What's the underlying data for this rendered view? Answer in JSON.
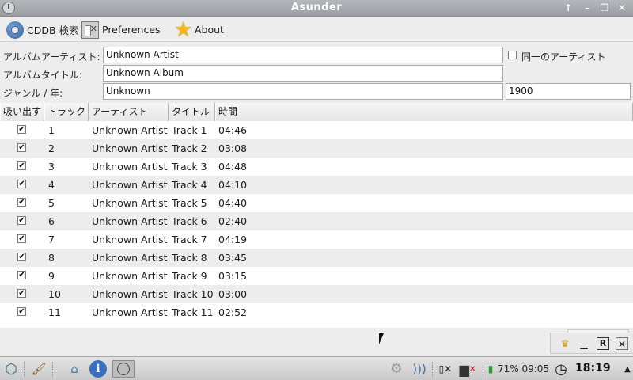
{
  "window": {
    "title": "Asunder",
    "buttons": {
      "up": "↑",
      "minimize": "–",
      "restore": "❐",
      "close": "✕"
    }
  },
  "toolbar": {
    "cddb_label": "CDDB 検索",
    "preferences_label": "Preferences",
    "about_label": "About"
  },
  "form": {
    "album_artist_label": "アルバムアーティスト:",
    "album_artist_value": "Unknown Artist",
    "single_artist_label": "同一のアーティスト",
    "album_title_label": "アルバムタイトル:",
    "album_title_value": "Unknown Album",
    "genre_year_label": "ジャンル / 年:",
    "genre_value": "Unknown",
    "year_value": "1900"
  },
  "table": {
    "headers": [
      "吸い出す",
      "トラック",
      "アーティスト",
      "タイトル",
      "時間"
    ],
    "rows": [
      {
        "rip": true,
        "track": "1",
        "artist": "Unknown Artist",
        "title": "Track 1",
        "time": "04:46"
      },
      {
        "rip": true,
        "track": "2",
        "artist": "Unknown Artist",
        "title": "Track 2",
        "time": "03:08"
      },
      {
        "rip": true,
        "track": "3",
        "artist": "Unknown Artist",
        "title": "Track 3",
        "time": "04:48"
      },
      {
        "rip": true,
        "track": "4",
        "artist": "Unknown Artist",
        "title": "Track 4",
        "time": "04:10"
      },
      {
        "rip": true,
        "track": "5",
        "artist": "Unknown Artist",
        "title": "Track 5",
        "time": "04:40"
      },
      {
        "rip": true,
        "track": "6",
        "artist": "Unknown Artist",
        "title": "Track 6",
        "time": "02:40"
      },
      {
        "rip": true,
        "track": "7",
        "artist": "Unknown Artist",
        "title": "Track 7",
        "time": "04:19"
      },
      {
        "rip": true,
        "track": "8",
        "artist": "Unknown Artist",
        "title": "Track 8",
        "time": "03:45"
      },
      {
        "rip": true,
        "track": "9",
        "artist": "Unknown Artist",
        "title": "Track 9",
        "time": "03:15"
      },
      {
        "rip": true,
        "track": "10",
        "artist": "Unknown Artist",
        "title": "Track 10",
        "time": "03:00"
      },
      {
        "rip": true,
        "track": "11",
        "artist": "Unknown Artist",
        "title": "Track 11",
        "time": "02:52"
      }
    ]
  },
  "tray_popup": {
    "icons": [
      "crown-icon",
      "minimize-icon",
      "r-icon",
      "close-icon"
    ],
    "r_label": "R"
  },
  "taskbar": {
    "battery": "71% 09:05",
    "clock": "18:19",
    "icons": [
      "start-menu-icon",
      "paint-icon",
      "home-folder-icon",
      "info-icon",
      "asunder-icon",
      "settings-gear-icon",
      "wifi-icon",
      "prefs-icon",
      "network-icon",
      "battery-icon",
      "clock-icon",
      "tray-arrow-icon"
    ]
  },
  "colors": {
    "titlebar": "#a6a9ad",
    "row_alt": "#ededed",
    "star": "#f1b81c",
    "info_blue": "#3a6fc0"
  }
}
